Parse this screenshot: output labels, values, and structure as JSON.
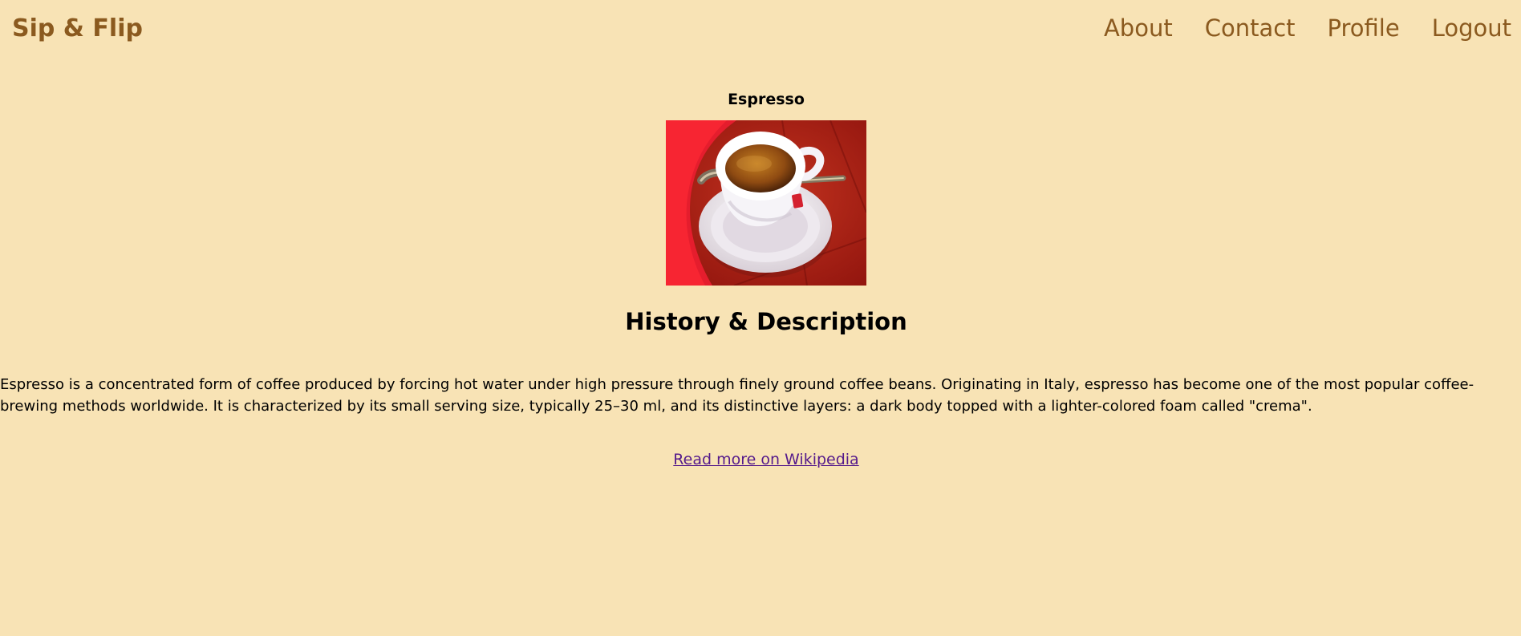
{
  "header": {
    "brand": "Sip & Flip",
    "nav": [
      {
        "label": "About"
      },
      {
        "label": "Contact"
      },
      {
        "label": "Profile"
      },
      {
        "label": "Logout"
      }
    ]
  },
  "main": {
    "drink_name": "Espresso",
    "image": {
      "icon": "espresso-cup-photo"
    },
    "section_heading": "History & Description",
    "description": "Espresso is a concentrated form of coffee produced by forcing hot water under high pressure through finely ground coffee beans. Originating in Italy, espresso has become one of the most popular coffee-brewing methods worldwide. It is characterized by its small serving size, typically 25–30 ml, and its distinctive layers: a dark body topped with a lighter-colored foam called \"crema\".",
    "wiki_link": "Read more on Wikipedia"
  },
  "colors": {
    "background": "#f8e3b5",
    "brand": "#8b5a1f",
    "link_visited": "#551a8b"
  }
}
